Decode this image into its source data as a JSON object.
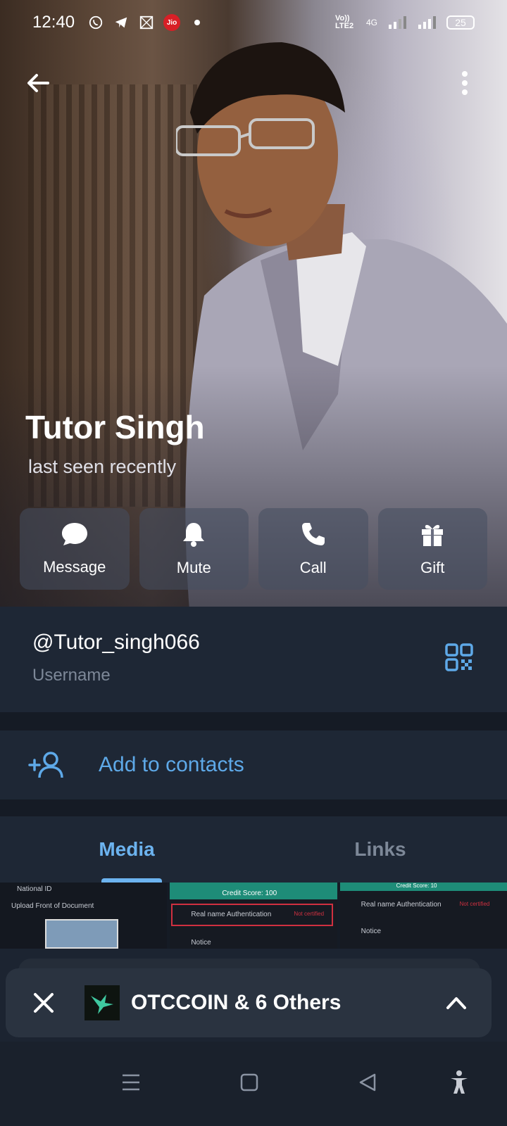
{
  "status_bar": {
    "time": "12:40",
    "left_icons": [
      "whatsapp-icon",
      "telegram-icon",
      "app-icon",
      "jio-icon",
      "dot-icon"
    ],
    "carrier_badge": "Jio",
    "network_label": "Vo)) LTE2",
    "network_type": "4G",
    "battery": "25"
  },
  "profile": {
    "name": "Tutor Singh",
    "status": "last seen recently"
  },
  "actions": [
    {
      "label": "Message",
      "icon": "message-bubble-icon"
    },
    {
      "label": "Mute",
      "icon": "bell-icon"
    },
    {
      "label": "Call",
      "icon": "phone-icon"
    },
    {
      "label": "Gift",
      "icon": "gift-icon"
    }
  ],
  "username": {
    "value": "@Tutor_singh066",
    "label": "Username"
  },
  "add_contact": {
    "label": "Add to contacts"
  },
  "tabs": [
    {
      "label": "Media",
      "active": true
    },
    {
      "label": "Links",
      "active": false
    }
  ],
  "media_thumbs": {
    "thumb1": {
      "lines": [
        "National ID",
        "Upload Front of Document"
      ]
    },
    "thumb2": {
      "lines": [
        "Credit Score: 100",
        "Real name Authentication",
        "Not certified",
        "Notice"
      ]
    },
    "thumb3": {
      "lines": [
        "Credit Score: 10",
        "Real name Authentication",
        "Not certified",
        "Notice"
      ]
    }
  },
  "player": {
    "title": "OTCCOIN & 6 Others"
  },
  "colors": {
    "accent": "#6cb3ef",
    "link": "#5ea9e8",
    "background": "#1e2735",
    "separator": "#151b25"
  }
}
